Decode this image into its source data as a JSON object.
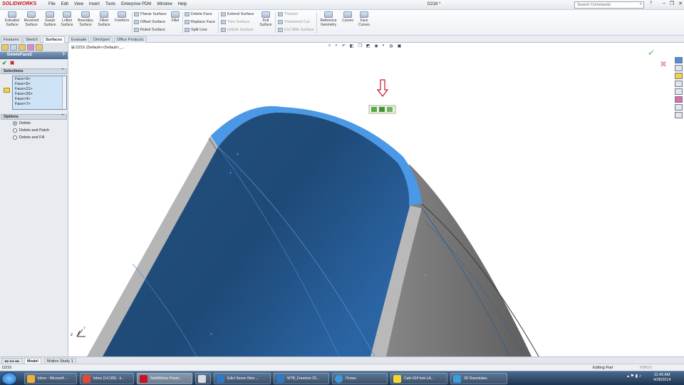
{
  "app": {
    "logo": "SOLIDWORKS",
    "doc_title": "D216 *"
  },
  "menu": [
    "File",
    "Edit",
    "View",
    "Insert",
    "Tools",
    "Enterprise PDM",
    "Window",
    "Help"
  ],
  "search": {
    "placeholder": "Search Commands"
  },
  "window_controls": [
    "–",
    "❐",
    "✕"
  ],
  "ribbon": {
    "big": [
      {
        "label": "Extruded\nSurface"
      },
      {
        "label": "Revolved\nSurface"
      },
      {
        "label": "Swept\nSurface"
      },
      {
        "label": "Lofted\nSurface"
      },
      {
        "label": "Boundary\nSurface"
      },
      {
        "label": "Filled\nSurface"
      },
      {
        "label": "Freeform"
      }
    ],
    "col1": [
      "Planar Surface",
      "Offset Surface",
      "Ruled Surface"
    ],
    "fillet": "Fillet",
    "col2": [
      "Delete Face",
      "Replace Face",
      "Split Line"
    ],
    "col3": [
      "Extend Surface",
      "Trim Surface",
      "Untrim Surface"
    ],
    "knit": "Knit\nSurface",
    "col4": [
      "Thicken",
      "Thickened Cut",
      "Cut With Surface"
    ],
    "right": [
      {
        "label": "Reference\nGeometry"
      },
      {
        "label": "Curves"
      },
      {
        "label": "Face\nCurves"
      }
    ]
  },
  "tabs": [
    "Features",
    "Sketch",
    "Surfaces",
    "Evaluate",
    "DimXpert",
    "Office Products"
  ],
  "active_tab": "Surfaces",
  "panel": {
    "title": "DeleteFace2",
    "help": "?",
    "ok": "✔",
    "cancel": "✖",
    "selections_title": "Selections",
    "faces": [
      "Face<6>",
      "Face<5>",
      "Face<21>",
      "Face<20>",
      "Face<4>",
      "Face<7>"
    ],
    "options_title": "Options",
    "options": [
      {
        "label": "Delete",
        "selected": true
      },
      {
        "label": "Delete and Patch",
        "selected": false
      },
      {
        "label": "Delete and Fill",
        "selected": false
      }
    ]
  },
  "tree": {
    "label": "D216  (Default<<Default>_..."
  },
  "bottom_tabs": [
    "Model",
    "Motion Study 1"
  ],
  "active_bottom_tab": "Model",
  "status": {
    "left": "D216",
    "mode": "Editing Part",
    "units": "MMGS"
  },
  "taskbar": {
    "items": [
      {
        "label": "Inbox - Microsoft ...",
        "color": "#f0b13a"
      },
      {
        "label": "Inbox (14,185) - k...",
        "color": "#e44a2f"
      },
      {
        "label": "SolidWorks Premi...",
        "color": "#c8141e"
      },
      {
        "label": "",
        "color": "#d9dde3"
      },
      {
        "label": "Edict Seven Nine ...",
        "color": "#2e79c8"
      },
      {
        "label": "WTB_Freedom 20...",
        "color": "#2e79c8"
      },
      {
        "label": "iTunes",
        "color": "#3a9be0"
      },
      {
        "label": "Cafe 624 fork-LA...",
        "color": "#f3d630"
      },
      {
        "label": "3D Downtubes",
        "color": "#3a9be0"
      }
    ],
    "time": "11:45 AM",
    "date": "4/28/2014"
  },
  "colors": {
    "accent": "#4a98e6",
    "face_dark": "#1c4a7a",
    "face_gray": "#8c8c8c"
  }
}
